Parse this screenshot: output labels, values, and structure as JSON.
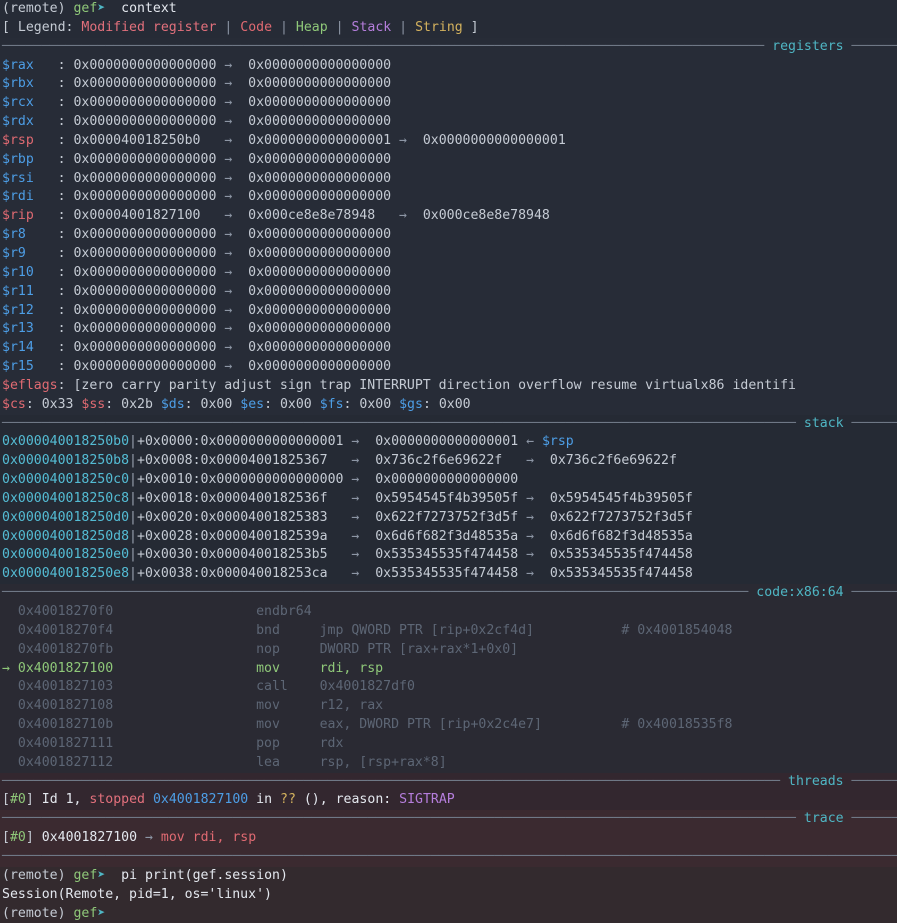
{
  "terminal": {
    "prompt_remote": "(remote)",
    "prompt_gef": "gef",
    "prompt_arrow": "➤",
    "command_1": "context",
    "command_2": "pi print(gef.session)",
    "session_output": "Session(Remote, pid=1, os='linux')"
  },
  "legend": {
    "open": "[ Legend:",
    "modified_register": "Modified register",
    "code": "Code",
    "heap": "Heap",
    "stack": "Stack",
    "string": "String",
    "close": "]",
    "pipe": "|"
  },
  "sections": {
    "registers": "registers",
    "stack": "stack",
    "code": "code:x86:64",
    "threads": "threads",
    "trace": "trace"
  },
  "registers": [
    {
      "name": "$rax",
      "modified": false,
      "value": "0x0000000000000000",
      "deref1": "0x0000000000000000",
      "deref2": ""
    },
    {
      "name": "$rbx",
      "modified": false,
      "value": "0x0000000000000000",
      "deref1": "0x0000000000000000",
      "deref2": ""
    },
    {
      "name": "$rcx",
      "modified": false,
      "value": "0x0000000000000000",
      "deref1": "0x0000000000000000",
      "deref2": ""
    },
    {
      "name": "$rdx",
      "modified": false,
      "value": "0x0000000000000000",
      "deref1": "0x0000000000000000",
      "deref2": ""
    },
    {
      "name": "$rsp",
      "modified": true,
      "value": "0x000040018250b0",
      "deref1": "0x0000000000000001",
      "deref2": "0x0000000000000001"
    },
    {
      "name": "$rbp",
      "modified": false,
      "value": "0x0000000000000000",
      "deref1": "0x0000000000000000",
      "deref2": ""
    },
    {
      "name": "$rsi",
      "modified": false,
      "value": "0x0000000000000000",
      "deref1": "0x0000000000000000",
      "deref2": ""
    },
    {
      "name": "$rdi",
      "modified": false,
      "value": "0x0000000000000000",
      "deref1": "0x0000000000000000",
      "deref2": ""
    },
    {
      "name": "$rip",
      "modified": true,
      "value": "0x00004001827100",
      "deref1": "0x000ce8e8e78948",
      "deref2": "0x000ce8e8e78948"
    },
    {
      "name": "$r8",
      "modified": false,
      "value": "0x0000000000000000",
      "deref1": "0x0000000000000000",
      "deref2": ""
    },
    {
      "name": "$r9",
      "modified": false,
      "value": "0x0000000000000000",
      "deref1": "0x0000000000000000",
      "deref2": ""
    },
    {
      "name": "$r10",
      "modified": false,
      "value": "0x0000000000000000",
      "deref1": "0x0000000000000000",
      "deref2": ""
    },
    {
      "name": "$r11",
      "modified": false,
      "value": "0x0000000000000000",
      "deref1": "0x0000000000000000",
      "deref2": ""
    },
    {
      "name": "$r12",
      "modified": false,
      "value": "0x0000000000000000",
      "deref1": "0x0000000000000000",
      "deref2": ""
    },
    {
      "name": "$r13",
      "modified": false,
      "value": "0x0000000000000000",
      "deref1": "0x0000000000000000",
      "deref2": ""
    },
    {
      "name": "$r14",
      "modified": false,
      "value": "0x0000000000000000",
      "deref1": "0x0000000000000000",
      "deref2": ""
    },
    {
      "name": "$r15",
      "modified": false,
      "value": "0x0000000000000000",
      "deref1": "0x0000000000000000",
      "deref2": ""
    }
  ],
  "eflags": {
    "name": "$eflags",
    "value": ": [zero carry parity adjust sign trap INTERRUPT direction overflow resume virtualx86 identifi"
  },
  "segments": [
    {
      "name": "$cs",
      "modified": true,
      "value": "0x33"
    },
    {
      "name": "$ss",
      "modified": true,
      "value": "0x2b"
    },
    {
      "name": "$ds",
      "modified": false,
      "value": "0x00"
    },
    {
      "name": "$es",
      "modified": false,
      "value": "0x00"
    },
    {
      "name": "$fs",
      "modified": false,
      "value": "0x00"
    },
    {
      "name": "$gs",
      "modified": false,
      "value": "0x00"
    }
  ],
  "stack_rows": [
    {
      "addr": "0x000040018250b0",
      "offset": "+0x0000:",
      "value": "0x0000000000000001",
      "deref1": "0x0000000000000001",
      "deref2": "",
      "tag": "$rsp"
    },
    {
      "addr": "0x000040018250b8",
      "offset": "+0x0008:",
      "value": "0x00004001825367",
      "deref1": "0x736c2f6e69622f",
      "deref2": "0x736c2f6e69622f",
      "tag": ""
    },
    {
      "addr": "0x000040018250c0",
      "offset": "+0x0010:",
      "value": "0x0000000000000000",
      "deref1": "0x0000000000000000",
      "deref2": "",
      "tag": ""
    },
    {
      "addr": "0x000040018250c8",
      "offset": "+0x0018:",
      "value": "0x0000400182536f",
      "deref1": "0x5954545f4b39505f",
      "deref2": "0x5954545f4b39505f",
      "tag": ""
    },
    {
      "addr": "0x000040018250d0",
      "offset": "+0x0020:",
      "value": "0x00004001825383",
      "deref1": "0x622f7273752f3d5f",
      "deref2": "0x622f7273752f3d5f",
      "tag": ""
    },
    {
      "addr": "0x000040018250d8",
      "offset": "+0x0028:",
      "value": "0x0000400182539a",
      "deref1": "0x6d6f682f3d48535a",
      "deref2": "0x6d6f682f3d48535a",
      "tag": ""
    },
    {
      "addr": "0x000040018250e0",
      "offset": "+0x0030:",
      "value": "0x000040018253b5",
      "deref1": "0x535345535f474458",
      "deref2": "0x535345535f474458",
      "tag": ""
    },
    {
      "addr": "0x000040018250e8",
      "offset": "+0x0038:",
      "value": "0x000040018253ca",
      "deref1": "0x535345535f474458",
      "deref2": "0x535345535f474458",
      "tag": ""
    }
  ],
  "code_rows": [
    {
      "marker": "",
      "addr": "0x40018270f0",
      "prefix": "",
      "mnemonic": "endbr64",
      "operands": "",
      "comment": "",
      "current": false
    },
    {
      "marker": "",
      "addr": "0x40018270f4",
      "prefix": "bnd",
      "mnemonic": "jmp",
      "operands": "QWORD PTR [rip+0x2cf4d]",
      "comment": "# 0x4001854048",
      "current": false
    },
    {
      "marker": "",
      "addr": "0x40018270fb",
      "prefix": "nop",
      "mnemonic": "DWORD",
      "operands": "PTR [rax+rax*1+0x0]",
      "comment": "",
      "current": false
    },
    {
      "marker": "→",
      "addr": "0x4001827100",
      "prefix": "",
      "mnemonic": "mov",
      "operands": "rdi, rsp",
      "comment": "",
      "current": true
    },
    {
      "marker": "",
      "addr": "0x4001827103",
      "prefix": "",
      "mnemonic": "call",
      "operands": "0x4001827df0",
      "comment": "",
      "current": false
    },
    {
      "marker": "",
      "addr": "0x4001827108",
      "prefix": "",
      "mnemonic": "mov",
      "operands": "r12, rax",
      "comment": "",
      "current": false
    },
    {
      "marker": "",
      "addr": "0x400182710b",
      "prefix": "",
      "mnemonic": "mov",
      "operands": "eax, DWORD PTR [rip+0x2c4e7]",
      "comment": "# 0x40018535f8",
      "current": false
    },
    {
      "marker": "",
      "addr": "0x4001827111",
      "prefix": "",
      "mnemonic": "pop",
      "operands": "rdx",
      "comment": "",
      "current": false
    },
    {
      "marker": "",
      "addr": "0x4001827112",
      "prefix": "",
      "mnemonic": "lea",
      "operands": "rsp, [rsp+rax*8]",
      "comment": "",
      "current": false
    }
  ],
  "threads_line": {
    "bracket_open": "[",
    "index": "#0",
    "bracket_close": "]",
    "id_text": "Id 1,",
    "state": "stopped",
    "address": "0x4001827100",
    "in_text": "in",
    "func": "??",
    "parens": "(), reason:",
    "signal": "SIGTRAP"
  },
  "trace_line": {
    "bracket_open": "[",
    "index": "#0",
    "bracket_close": "]",
    "address": "0x4001827100",
    "arrow": "→",
    "instruction": "mov rdi, rsp"
  },
  "glyphs": {
    "deref_arrow": "→",
    "left_arrow": "←",
    "colon": ":",
    "vbar": "|"
  },
  "colors": {
    "background": "#262b36",
    "modified_register": "#e06a72",
    "register_name": "#4d9ee6",
    "section_title": "#4fb6c4",
    "stack_address": "#54bcd4",
    "current_instruction": "#8fc879",
    "signal": "#b57edc",
    "string": "#d4b25e"
  }
}
